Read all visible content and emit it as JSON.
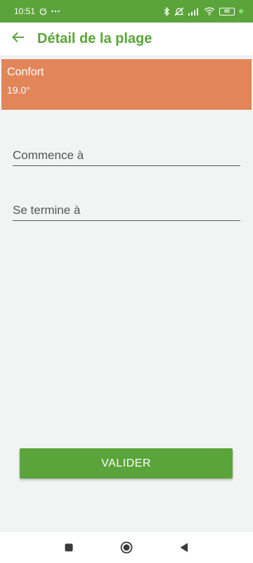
{
  "status_bar": {
    "time": "10:51",
    "battery": "65",
    "icons": [
      "sync-icon",
      "more-icon",
      "bluetooth-icon",
      "mute-icon",
      "signal-icon",
      "wifi-icon",
      "battery-icon"
    ]
  },
  "header": {
    "title": "Détail de la plage",
    "back_icon": "arrow-left-icon"
  },
  "slot": {
    "name": "Confort",
    "temperature": "19.0°"
  },
  "form": {
    "start_placeholder": "Commence à",
    "end_placeholder": "Se termine à"
  },
  "actions": {
    "validate_label": "VALIDER"
  },
  "nav_bar": {
    "icons": [
      "recent-apps-icon",
      "home-icon",
      "back-icon"
    ]
  },
  "colors": {
    "primary": "#5ba43b",
    "slot_background": "#e2865a",
    "page_background": "#f2f4f4"
  }
}
